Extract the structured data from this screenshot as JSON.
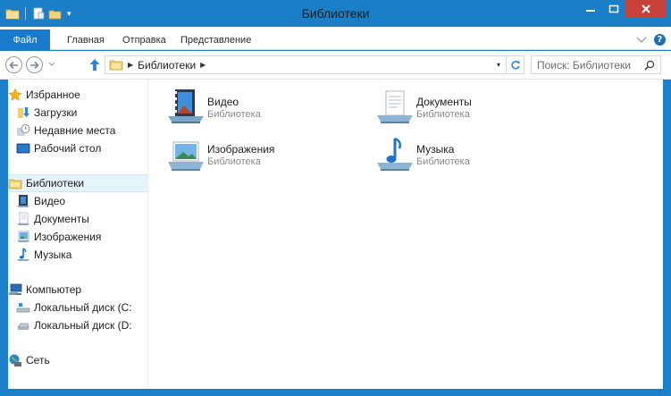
{
  "window": {
    "title": "Библиотеки",
    "accent_color": "#1b7fc8",
    "close_color": "#c7403a"
  },
  "quick_access": {
    "icons": [
      "folder-icon",
      "properties-icon",
      "new-folder-icon"
    ],
    "dropdown_glyph": "▾"
  },
  "window_buttons": {
    "minimize_icon": "minimize-icon",
    "maximize_icon": "maximize-icon",
    "close_icon": "close-icon"
  },
  "ribbon": {
    "file_tab": "Файл",
    "tabs": [
      "Главная",
      "Отправка",
      "Представление"
    ],
    "expand_icon": "chevron-down-icon",
    "help_label": "?"
  },
  "navigation": {
    "back_icon": "back-arrow-icon",
    "forward_icon": "forward-arrow-icon",
    "recent_icon": "chevron-down-icon",
    "up_icon": "up-arrow-icon"
  },
  "address": {
    "crumbs": [
      "Библиотеки"
    ],
    "crumb_separator": "▶",
    "dropdown_glyph": "▾",
    "refresh_icon": "refresh-icon"
  },
  "search": {
    "placeholder": "Поиск: Библиотеки",
    "icon": "search-icon"
  },
  "sidebar": {
    "groups": [
      {
        "items": [
          {
            "label": "Избранное",
            "icon": "star-icon"
          },
          {
            "label": "Загрузки",
            "icon": "downloads-icon"
          },
          {
            "label": "Недавние места",
            "icon": "recent-places-icon"
          },
          {
            "label": "Рабочий стол",
            "icon": "desktop-icon"
          }
        ]
      },
      {
        "items": [
          {
            "label": "Библиотеки",
            "icon": "libraries-icon",
            "selected": true
          },
          {
            "label": "Видео",
            "icon": "video-icon"
          },
          {
            "label": "Документы",
            "icon": "documents-icon"
          },
          {
            "label": "Изображения",
            "icon": "pictures-icon"
          },
          {
            "label": "Музыка",
            "icon": "music-icon"
          }
        ]
      },
      {
        "items": [
          {
            "label": "Компьютер",
            "icon": "computer-icon"
          },
          {
            "label": "Локальный диск (C:",
            "icon": "drive-icon"
          },
          {
            "label": "Локальный диск (D:",
            "icon": "drive-icon"
          }
        ]
      },
      {
        "items": [
          {
            "label": "Сеть",
            "icon": "network-icon"
          }
        ]
      }
    ]
  },
  "libraries": [
    {
      "name": "Видео",
      "type": "Библиотека",
      "icon": "video-library-icon"
    },
    {
      "name": "Документы",
      "type": "Библиотека",
      "icon": "documents-library-icon"
    },
    {
      "name": "Изображения",
      "type": "Библиотека",
      "icon": "pictures-library-icon"
    },
    {
      "name": "Музыка",
      "type": "Библиотека",
      "icon": "music-library-icon"
    }
  ]
}
